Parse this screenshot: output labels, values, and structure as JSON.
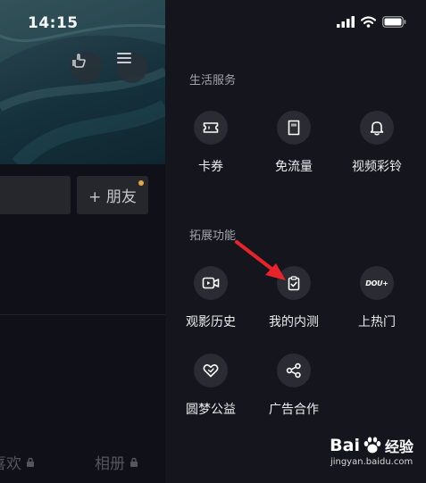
{
  "status_bar": {
    "time": "14:15"
  },
  "left_page": {
    "friend_button": "+ 朋友",
    "tabs": [
      {
        "label": "喜欢"
      },
      {
        "label": "相册"
      }
    ]
  },
  "drawer": {
    "sections": [
      {
        "title": "生活服务",
        "items": [
          {
            "label": "卡券",
            "icon": "ticket-icon"
          },
          {
            "label": "免流量",
            "icon": "sim-card-icon"
          },
          {
            "label": "视频彩铃",
            "icon": "bell-icon"
          }
        ]
      },
      {
        "title": "拓展功能",
        "items": [
          {
            "label": "观影历史",
            "icon": "video-history-icon"
          },
          {
            "label": "我的内测",
            "icon": "checklist-icon"
          },
          {
            "label": "上热门",
            "icon": "dou-plus-icon"
          },
          {
            "label": "圆梦公益",
            "icon": "heart-icon"
          },
          {
            "label": "广告合作",
            "icon": "share-icon"
          }
        ]
      }
    ],
    "dou_plus_text": "DOU+"
  },
  "watermark": {
    "brand": "Bai",
    "brand_suffix": "经验",
    "url": "jingyan.baidu.com"
  }
}
